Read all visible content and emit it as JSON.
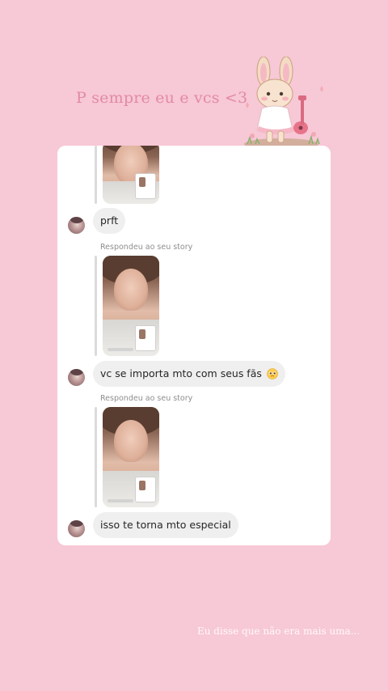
{
  "story": {
    "background_color": "#f7c8d6",
    "caption_top": "P sempre eu e vcs <3",
    "caption_bottom": "Eu disse que não era mais uma..."
  },
  "sticker": {
    "icon": "bunny-with-guitar-sticker"
  },
  "chat": {
    "reply_label": "Respondeu ao seu story",
    "messages": [
      {
        "text": "prft"
      },
      {
        "text": "vc se importa mto com seus fãs",
        "emoji": "pleading-face-icon"
      },
      {
        "text": "isso te torna mto especial"
      }
    ]
  }
}
